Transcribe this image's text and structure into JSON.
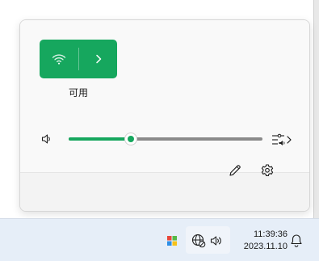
{
  "quick_settings": {
    "wifi_tile": {
      "label": "可用",
      "icon": "wifi-icon",
      "more_icon": "chevron-right-icon",
      "active": true
    },
    "volume": {
      "level": 0.32,
      "icon": "speaker-icon",
      "mixer_icon": "audio-mixer-icon"
    },
    "footer": {
      "edit_icon": "pencil-icon",
      "settings_icon": "gear-icon"
    }
  },
  "taskbar": {
    "start_icon": "windows-logo-icon",
    "tray": {
      "network_icon": "globe-no-internet-icon",
      "volume_icon": "speaker-icon"
    },
    "clock": {
      "time": "11:39:36",
      "date": "2023.11.10"
    },
    "notification_icon": "bell-icon"
  },
  "colors": {
    "accent": "#16a75e",
    "panel_bg": "#f9f9f9",
    "footer_bg": "#f3f3f3",
    "taskbar_bg": "#e6eef8",
    "slider_track": "#8a8a8a"
  }
}
